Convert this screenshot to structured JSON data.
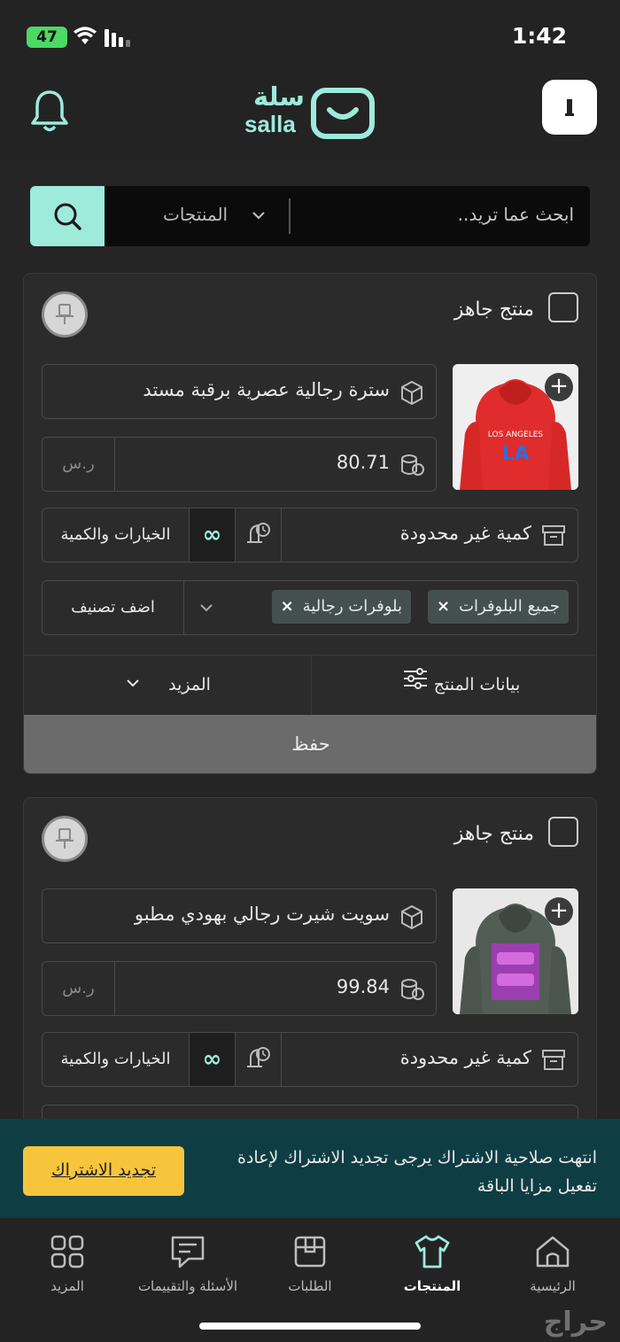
{
  "status": {
    "time": "1:42",
    "battery": "47"
  },
  "header": {
    "logo_ar": "سلة",
    "logo_en": "salla"
  },
  "search": {
    "placeholder": "ابحث عما تريد..",
    "category": "المنتجات"
  },
  "products": [
    {
      "ready_label": "منتج جاهز",
      "name": "سترة رجالية عصرية برقبة مستد",
      "price": "80.71",
      "currency": "ر.س",
      "quantity": "كمية غير محدودة",
      "options_label": "الخيارات والكمية",
      "infinity": "∞",
      "tags": [
        "جميع البلوفرات",
        "بلوفرات رجالية"
      ],
      "add_category": "اضف تصنيف",
      "tab_data": "بيانات المنتج",
      "tab_more": "المزيد",
      "save": "حفظ",
      "thumb_text": [
        "LOS ANGELES",
        "LA"
      ]
    },
    {
      "ready_label": "منتج جاهز",
      "name": "سويت شيرت رجالي بهودي مطبو",
      "price": "99.84",
      "currency": "ر.س",
      "quantity": "كمية غير محدودة",
      "options_label": "الخيارات والكمية",
      "infinity": "∞"
    }
  ],
  "banner": {
    "text": "انتهت صلاحية الاشتراك يرجى تجديد الاشتراك لإعادة تفعيل مزايا الباقة",
    "button": "تجديد الاشتراك"
  },
  "nav": {
    "home": "الرئيسية",
    "products": "المنتجات",
    "orders": "الطلبات",
    "reviews": "الأسئلة والتقييمات",
    "more": "المزيد"
  },
  "watermark": "حراج",
  "colors": {
    "accent": "#9eeadb",
    "banner": "#0f3d44",
    "renew": "#f6c53b"
  }
}
